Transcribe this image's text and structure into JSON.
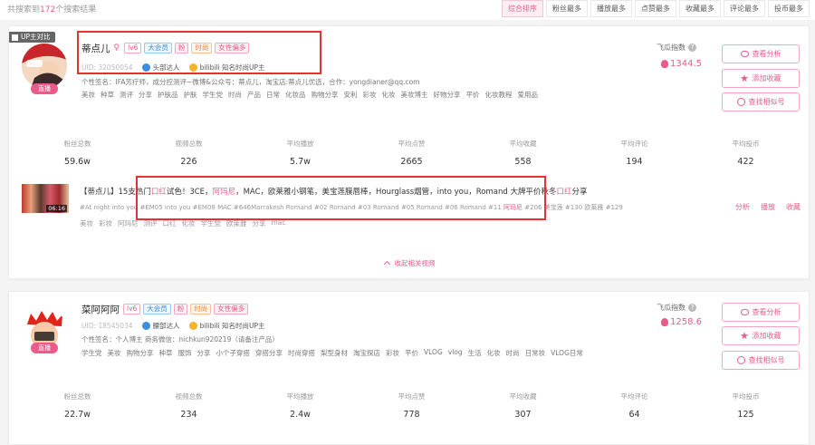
{
  "results": {
    "prefix": "共搜索到",
    "count": "172",
    "suffix": "个搜索结果"
  },
  "sort_tabs": [
    "综合排序",
    "粉丝最多",
    "播放最多",
    "点赞最多",
    "收藏最多",
    "评论最多",
    "投币最多"
  ],
  "compare_label": "UP主对比",
  "index_label": "飞瓜指数",
  "buttons": {
    "analysis": "查看分析",
    "favorite": "添加收藏",
    "similar": "查找相似号"
  },
  "live_label": "直播",
  "stat_labels": [
    "粉丝总数",
    "视频总数",
    "平均播放",
    "平均点赞",
    "平均收藏",
    "平均评论",
    "平均投币"
  ],
  "cards": [
    {
      "name": "蒂点儿",
      "gender": "♀",
      "tags": [
        "lv6",
        "大会员",
        "粉",
        "时尚",
        "女性偏多"
      ],
      "uid": "UID: 32050054",
      "meta1": "头部达人",
      "meta2": "bilibili 知名时尚UP主",
      "signature": "个性签名：IFA芳疗师，成分控测评~微博&公众号：蒂点儿，淘宝店:蒂点儿优选，合作：yongdianer@qq.com",
      "keywords": [
        "美妆",
        "种草",
        "测评",
        "分享",
        "护肤品",
        "护肤",
        "学生党",
        "时尚",
        "产品",
        "日常",
        "化妆品",
        "购物分享",
        "安利",
        "彩妆",
        "化妆",
        "美妆博主",
        "好物分享",
        "平价",
        "化妆教程",
        "爱用品"
      ],
      "index": "1344.5",
      "stats": [
        "59.6w",
        "226",
        "5.7w",
        "2665",
        "558",
        "194",
        "422"
      ]
    },
    {
      "name": "菜阿阿阿",
      "gender": "",
      "tags": [
        "lv6",
        "大会员",
        "粉",
        "时尚",
        "女性偏多"
      ],
      "uid": "UID: 18545034",
      "meta1": "腰部达人",
      "meta2": "bilibili 知名时尚UP主",
      "signature": "个性签名：个人博主 商务微信：nichkun920219（请备注产品）",
      "keywords": [
        "学生党",
        "美妆",
        "购物分享",
        "种草",
        "服饰",
        "分享",
        "小个子穿搭",
        "穿搭分享",
        "时尚穿搭",
        "梨型身材",
        "淘宝探店",
        "彩妆",
        "平价",
        "VLOG",
        "vlog",
        "生活",
        "化妆",
        "时尚",
        "日常妆",
        "VLOG日常"
      ],
      "index": "1258.6",
      "stats": [
        "22.7w",
        "234",
        "2.4w",
        "778",
        "307",
        "64",
        "125"
      ]
    }
  ],
  "video": {
    "duration": "06:16",
    "title_pre": "【蒂点儿】15支热门",
    "title_hl1": "口红",
    "title_mid": "试色！3CE，",
    "title_hl2": "阿玛尼",
    "title_post": "，MAC，欧莱雅小钢笔，美宝莲膜唇棒，Hourglass烟管，into you，Romand 大牌平价秋冬",
    "title_hl3": "口红",
    "title_end": "分享",
    "tags_pre": "#At night into you #EM05 into you #EM08 MAC #646Marrakesh Romand #02 Romand #03 Romand #05 Romand #06 Romand #11 ",
    "tags_hl": "阿玛尼",
    "tags_post": " #206 美宝莲 #130 欧莱雅 #129",
    "keywords": [
      "美妆",
      "彩妆",
      "阿玛尼",
      "测评",
      "口红",
      "化妆",
      "学生党",
      "欧莱雅",
      "分享",
      "mac"
    ],
    "actions": [
      "分析",
      "播放",
      "收藏"
    ]
  },
  "collapse_label": "收起相关视频"
}
